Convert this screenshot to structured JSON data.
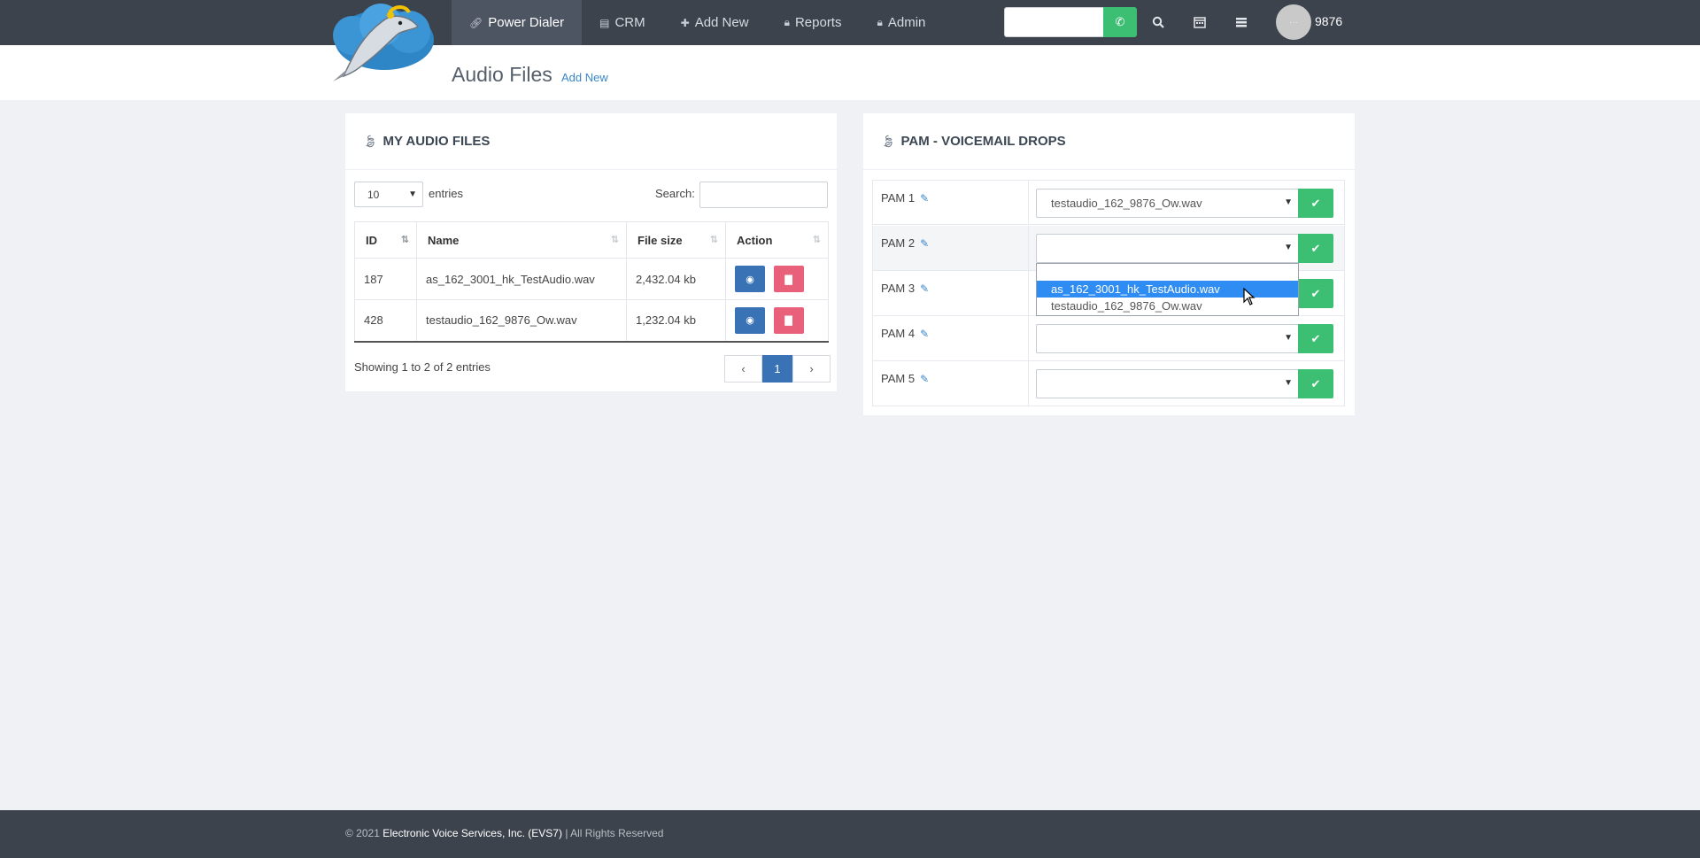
{
  "nav": {
    "items": [
      {
        "label": "Power Dialer",
        "icon": "link-icon",
        "active": true
      },
      {
        "label": "CRM",
        "icon": "book-icon",
        "active": false
      },
      {
        "label": "Add New",
        "icon": "plus-icon",
        "active": false
      },
      {
        "label": "Reports",
        "icon": "lock-icon",
        "active": false
      },
      {
        "label": "Admin",
        "icon": "lock-icon",
        "active": false
      }
    ],
    "dial_value": "",
    "user_name": "9876",
    "avatar_text": "···"
  },
  "header": {
    "title": "Audio Files",
    "add_link": "Add New"
  },
  "audio_files": {
    "title": "MY AUDIO FILES",
    "entries_value": "10",
    "entries_label": "entries",
    "search_label": "Search:",
    "search_value": "",
    "columns": [
      "ID",
      "Name",
      "File size",
      "Action"
    ],
    "rows": [
      {
        "id": "187",
        "name": "as_162_3001_hk_TestAudio.wav",
        "size": "2,432.04 kb"
      },
      {
        "id": "428",
        "name": "testaudio_162_9876_Ow.wav",
        "size": "1,232.04 kb"
      }
    ],
    "showing": "Showing 1 to 2 of 2 entries",
    "pager": {
      "prev": "‹",
      "current": "1",
      "next": "›"
    }
  },
  "pam": {
    "title": "PAM - VOICEMAIL DROPS",
    "rows": [
      {
        "label": "PAM 1",
        "value": "testaudio_162_9876_Ow.wav"
      },
      {
        "label": "PAM 2",
        "value": ""
      },
      {
        "label": "PAM 3",
        "value": ""
      },
      {
        "label": "PAM 4",
        "value": ""
      },
      {
        "label": "PAM 5",
        "value": ""
      }
    ],
    "dropdown_options": [
      "",
      "as_162_3001_hk_TestAudio.wav",
      "testaudio_162_9876_Ow.wav"
    ],
    "dropdown_selected": "as_162_3001_hk_TestAudio.wav"
  },
  "footer": {
    "year": "© 2021",
    "company": "Electronic Voice Services, Inc. (EVS7)",
    "rights": "| All Rights Reserved"
  },
  "colors": {
    "topbar": "#3d434d",
    "accent_green": "#3cbf73",
    "accent_blue": "#3a73b5",
    "danger": "#e8607a",
    "selected_option": "#2f8cf2"
  }
}
